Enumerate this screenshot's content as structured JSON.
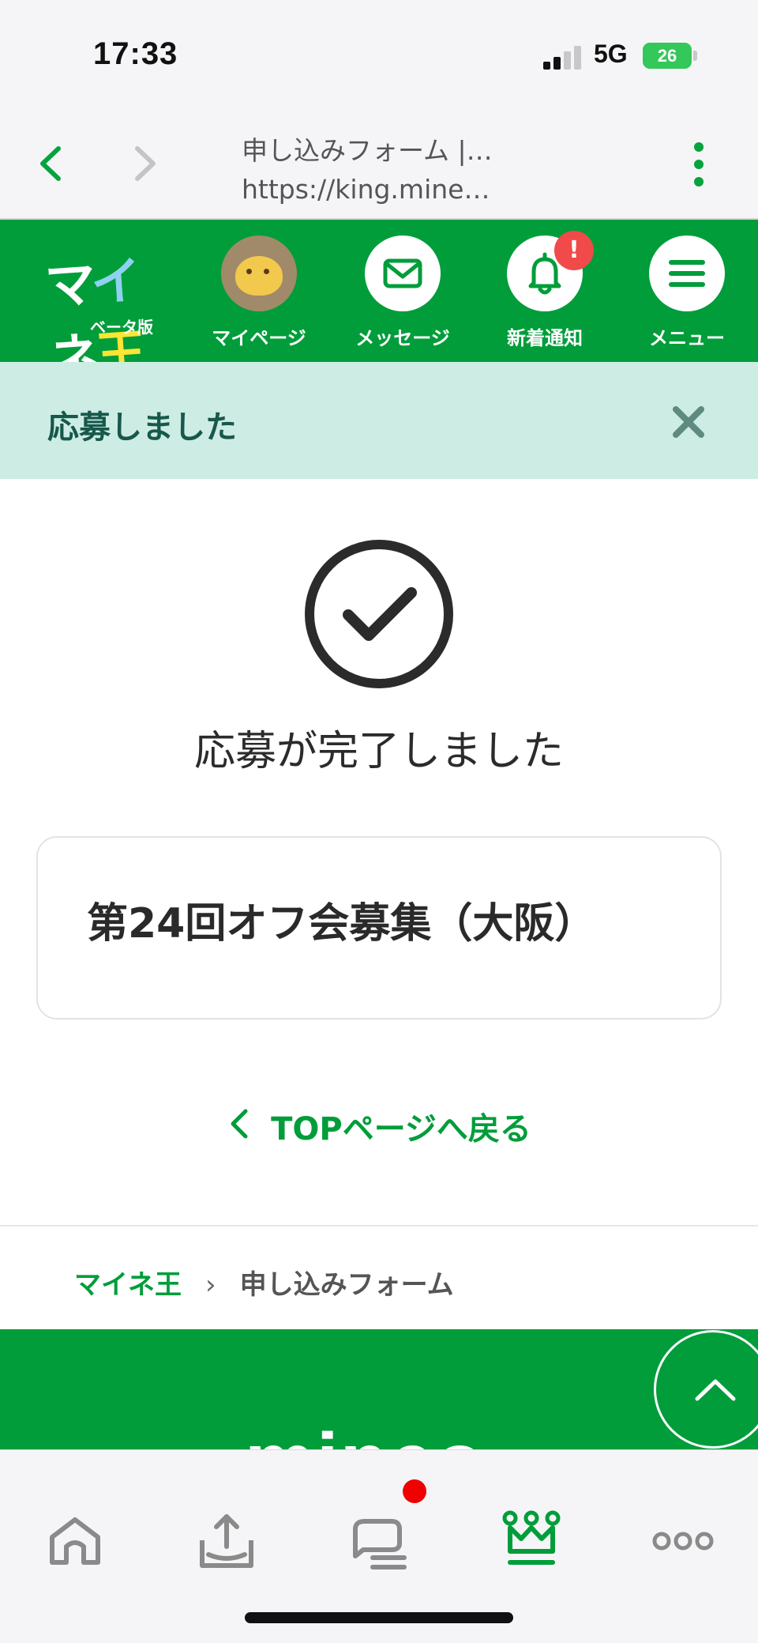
{
  "status_bar": {
    "time": "17:33",
    "network": "5G",
    "battery": "26"
  },
  "browser": {
    "page_title": "申し込みフォーム |…",
    "url": "https://king.mine…"
  },
  "header": {
    "logo_text": "マイネ王",
    "logo_sub": "ベータ版",
    "items": [
      {
        "label": "マイページ"
      },
      {
        "label": "メッセージ"
      },
      {
        "label": "新着通知",
        "badge": "!"
      },
      {
        "label": "メニュー"
      }
    ]
  },
  "flash": {
    "message": "応募しました"
  },
  "main": {
    "completion_text": "応募が完了しました",
    "event_title": "第24回オフ会募集（大阪）",
    "back_link": "TOPページへ戻る"
  },
  "breadcrumb": {
    "home": "マイネ王",
    "separator": "›",
    "current": "申し込みフォーム"
  },
  "footer": {
    "logo_text": "mineo"
  },
  "colors": {
    "brand_green": "#009d3a",
    "flash_bg": "#cdece4",
    "badge_red": "#f04a4a"
  },
  "tabbar": {
    "icons": [
      "home-icon",
      "upload-icon",
      "chat-icon",
      "crown-icon",
      "more-icon"
    ]
  }
}
